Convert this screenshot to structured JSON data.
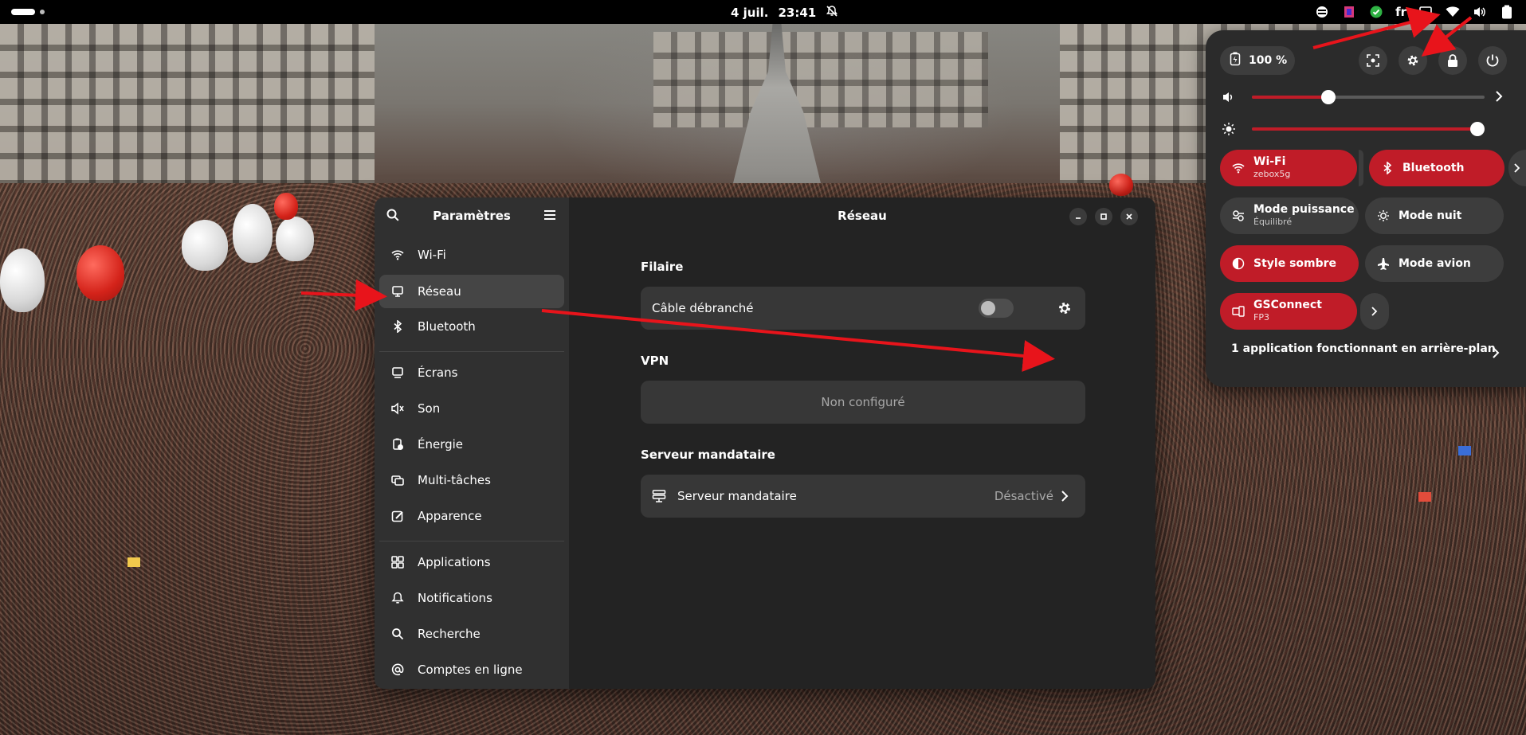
{
  "topbar": {
    "date": "4 juil.",
    "time": "23:41",
    "language": "fr",
    "icons": [
      "activities-indicator",
      "notifications-muted-icon",
      "app-indicator-1",
      "app-indicator-2",
      "app-indicator-3",
      "screen-cast-icon",
      "wifi-icon",
      "volume-icon",
      "battery-icon"
    ]
  },
  "settings": {
    "sidebar_title": "Paramètres",
    "nav": [
      {
        "label": "Wi-Fi",
        "icon": "wifi-icon"
      },
      {
        "label": "Réseau",
        "icon": "network-icon",
        "selected": true
      },
      {
        "label": "Bluetooth",
        "icon": "bluetooth-icon"
      },
      {
        "label": "Écrans",
        "icon": "display-icon"
      },
      {
        "label": "Son",
        "icon": "sound-icon"
      },
      {
        "label": "Énergie",
        "icon": "power-icon"
      },
      {
        "label": "Multi-tâches",
        "icon": "multitasking-icon"
      },
      {
        "label": "Apparence",
        "icon": "appearance-icon"
      },
      {
        "label": "Applications",
        "icon": "apps-icon"
      },
      {
        "label": "Notifications",
        "icon": "bell-icon"
      },
      {
        "label": "Recherche",
        "icon": "search-icon"
      },
      {
        "label": "Comptes en ligne",
        "icon": "at-icon"
      }
    ],
    "page_title": "Réseau",
    "wired": {
      "title": "Filaire",
      "row_label": "Câble débranché",
      "toggle_on": false
    },
    "vpn": {
      "title": "VPN",
      "empty_label": "Non configuré"
    },
    "proxy": {
      "title": "Serveur mandataire",
      "row_label": "Serveur mandataire",
      "value": "Désactivé"
    }
  },
  "quick_settings": {
    "battery": "100 %",
    "volume_level": 0.33,
    "brightness_level": 1.0,
    "tiles": {
      "wifi": {
        "label": "Wi-Fi",
        "sub": "zebox5g",
        "on": true
      },
      "bluetooth": {
        "label": "Bluetooth",
        "on": true
      },
      "power_mode": {
        "label": "Mode puissance",
        "sub": "Équilibré",
        "on": false
      },
      "night_mode": {
        "label": "Mode nuit",
        "on": false
      },
      "dark_style": {
        "label": "Style sombre",
        "on": true
      },
      "airplane": {
        "label": "Mode avion",
        "on": false
      },
      "gsconnect": {
        "label": "GSConnect",
        "sub": "FP3",
        "on": true
      }
    },
    "background_apps": "1 application fonctionnant en arrière-plan"
  },
  "colors": {
    "accent": "#c01c28",
    "annotation_arrow": "#e8141b",
    "sidebar_bg": "#303030",
    "content_bg": "#232323"
  }
}
